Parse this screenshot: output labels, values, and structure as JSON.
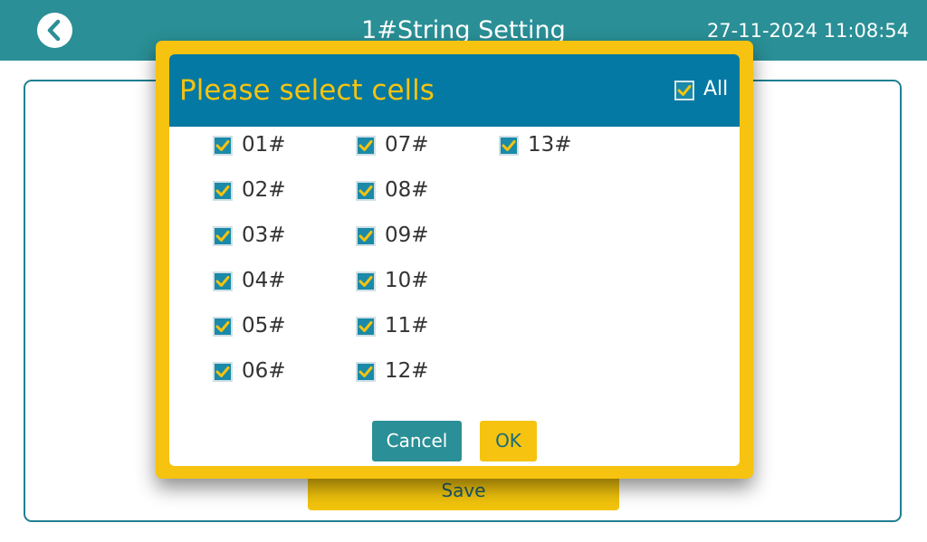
{
  "header": {
    "title": "1#String Setting",
    "datetime": "27-11-2024 11:08:54"
  },
  "main": {
    "save_label": "Save"
  },
  "dialog": {
    "title": "Please select cells",
    "all_label": "All",
    "all_checked": true,
    "cancel_label": "Cancel",
    "ok_label": "OK",
    "cells": [
      {
        "label": "01#",
        "checked": true
      },
      {
        "label": "02#",
        "checked": true
      },
      {
        "label": "03#",
        "checked": true
      },
      {
        "label": "04#",
        "checked": true
      },
      {
        "label": "05#",
        "checked": true
      },
      {
        "label": "06#",
        "checked": true
      },
      {
        "label": "07#",
        "checked": true
      },
      {
        "label": "08#",
        "checked": true
      },
      {
        "label": "09#",
        "checked": true
      },
      {
        "label": "10#",
        "checked": true
      },
      {
        "label": "11#",
        "checked": true
      },
      {
        "label": "12#",
        "checked": true
      },
      {
        "label": "13#",
        "checked": true
      }
    ]
  },
  "colors": {
    "topbar": "#2a8f96",
    "dialog_header": "#0479a3",
    "accent_yellow": "#f5c310",
    "checkbox_fill": "#1a8aa8"
  },
  "icons": {
    "back": "chevron-left-icon",
    "checkbox": "checkbox-checked-icon"
  }
}
